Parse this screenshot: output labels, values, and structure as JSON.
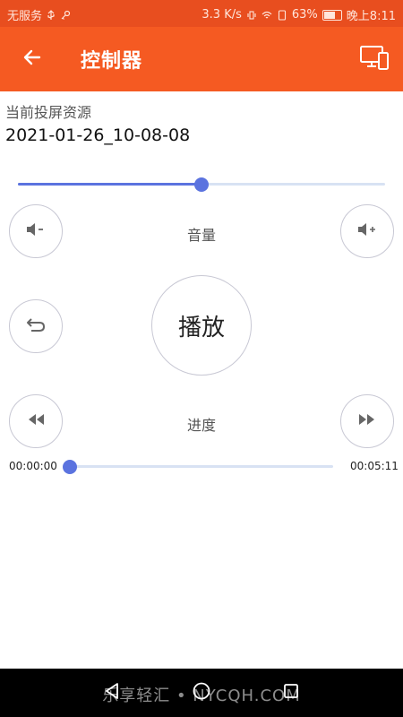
{
  "status_bar": {
    "carrier": "无服务",
    "speed": "3.3 K/s",
    "battery": "63%",
    "time": "晚上8:11"
  },
  "app_bar": {
    "title": "控制器",
    "back_icon": "arrow-left-icon",
    "cast_icon": "screen-cast-icon",
    "color": "#f55a22"
  },
  "source": {
    "label": "当前投屏资源",
    "value": "2021-01-26_10-08-08"
  },
  "volume": {
    "label": "音量",
    "level": 0.5,
    "down_icon": "volume-down-icon",
    "up_icon": "volume-up-icon"
  },
  "playback": {
    "play_label": "播放",
    "back_icon": "return-icon"
  },
  "progress": {
    "label": "进度",
    "current_time": "00:00:00",
    "total_time": "00:05:11",
    "fraction": 0.0,
    "rewind_icon": "rewind-icon",
    "forward_icon": "fast-forward-icon"
  },
  "accent_color": "#5b73df",
  "nav": {
    "back_icon": "nav-back-icon",
    "home_icon": "nav-home-icon",
    "recent_icon": "nav-recent-icon"
  },
  "watermark": "乐享轻汇 • NYCQH.COM"
}
